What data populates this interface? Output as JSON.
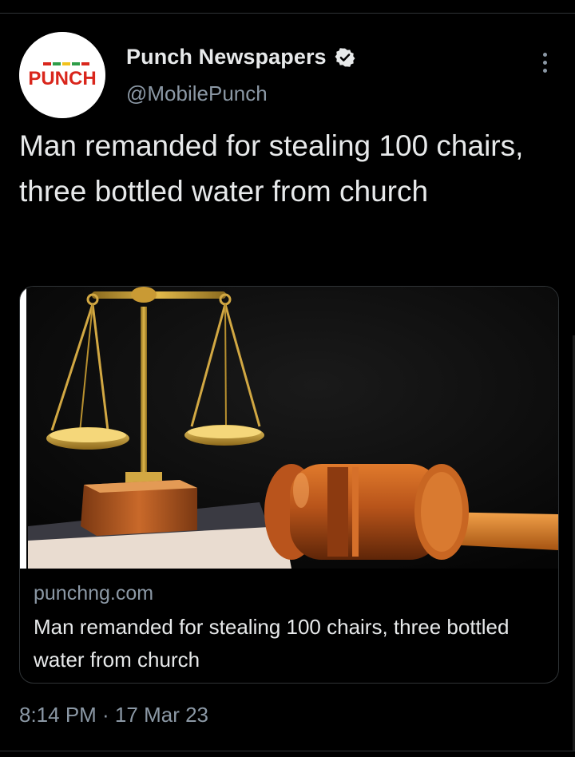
{
  "tweet": {
    "author_name": "Punch Newspapers",
    "author_handle": "@MobilePunch",
    "avatar_logo_text": "PUNCH",
    "text": "Man remanded for stealing 100 chairs, three bottled water from church",
    "timestamp": "8:14 PM · 17 Mar 23",
    "icons": {
      "verified": "verified-badge-icon",
      "more": "more-dots-icon"
    }
  },
  "card": {
    "domain": "punchng.com",
    "title": "Man remanded for stealing 100 chairs, three bottled water from church",
    "image_subject": "scales-and-gavel-image"
  },
  "colors": {
    "background": "#000000",
    "text_primary": "#e7e9ea",
    "text_secondary": "#8b98a5",
    "border": "#2f3336",
    "punch_red": "#d9261c",
    "punch_green": "#2e9d48",
    "punch_yellow": "#f2c21b"
  }
}
